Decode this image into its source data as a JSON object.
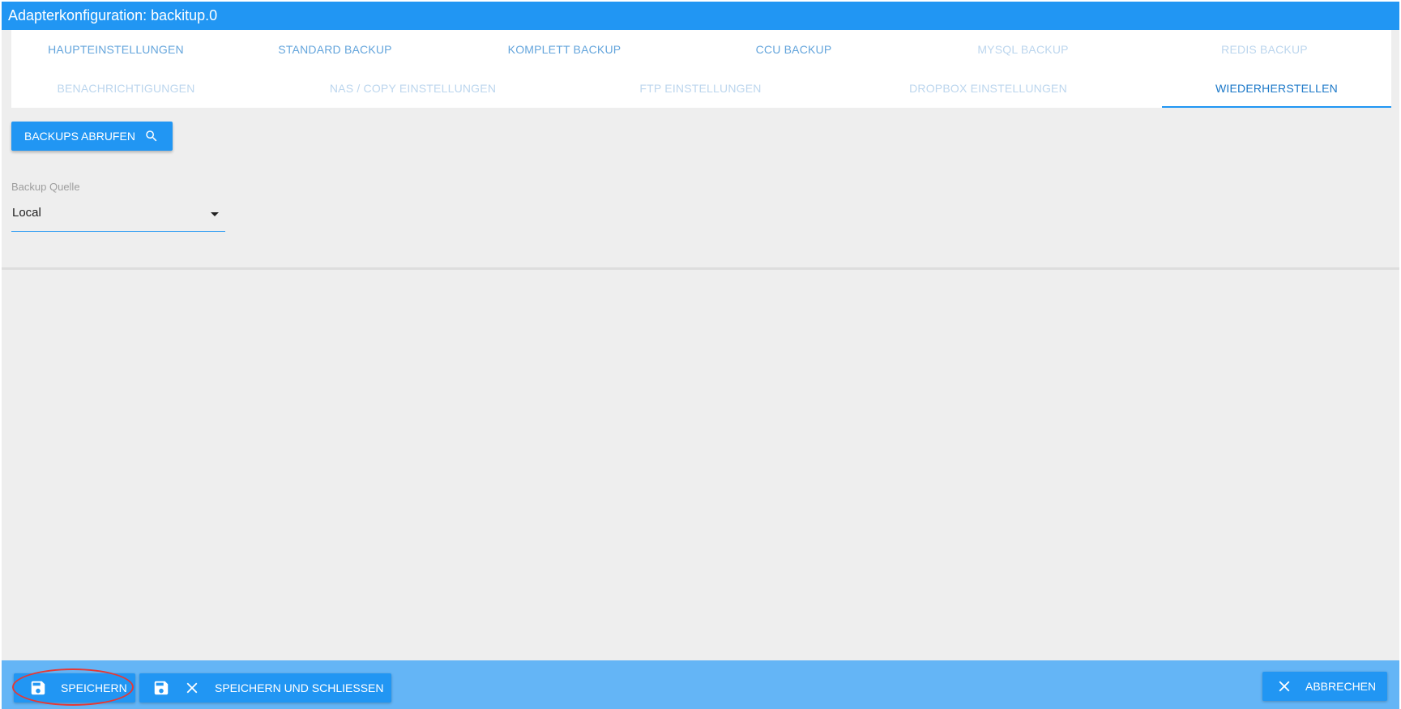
{
  "window": {
    "title": "Adapterkonfiguration: backitup.0"
  },
  "tabs": [
    {
      "label": "HAUPTEINSTELLUNGEN",
      "state": "enabled"
    },
    {
      "label": "STANDARD BACKUP",
      "state": "enabled"
    },
    {
      "label": "KOMPLETT BACKUP",
      "state": "enabled"
    },
    {
      "label": "CCU BACKUP",
      "state": "enabled"
    },
    {
      "label": "MYSQL BACKUP",
      "state": "muted"
    },
    {
      "label": "REDIS BACKUP",
      "state": "muted"
    },
    {
      "label": "BENACHRICHTIGUNGEN",
      "state": "muted"
    },
    {
      "label": "NAS / COPY EINSTELLUNGEN",
      "state": "muted"
    },
    {
      "label": "FTP EINSTELLUNGEN",
      "state": "muted"
    },
    {
      "label": "DROPBOX EINSTELLUNGEN",
      "state": "muted"
    },
    {
      "label": "WIEDERHERSTELLEN",
      "state": "active"
    }
  ],
  "restore": {
    "fetch_button": {
      "label": "BACKUPS ABRUFEN",
      "icon": "search-icon"
    },
    "source": {
      "label": "Backup Quelle",
      "value": "Local"
    }
  },
  "footer": {
    "save": {
      "label": "SPEICHERN",
      "icon": "save-icon"
    },
    "save_close": {
      "label": "SPEICHERN UND SCHLIESSEN",
      "icons": [
        "save-icon",
        "close-icon"
      ]
    },
    "cancel": {
      "label": "ABBRECHEN",
      "icon": "close-icon"
    }
  },
  "colors": {
    "primary": "#2196f3",
    "footer": "#64b5f6",
    "tab_text": "#64a5dc",
    "tab_text_muted": "#bcd6ee",
    "annotation": "#e53935"
  }
}
